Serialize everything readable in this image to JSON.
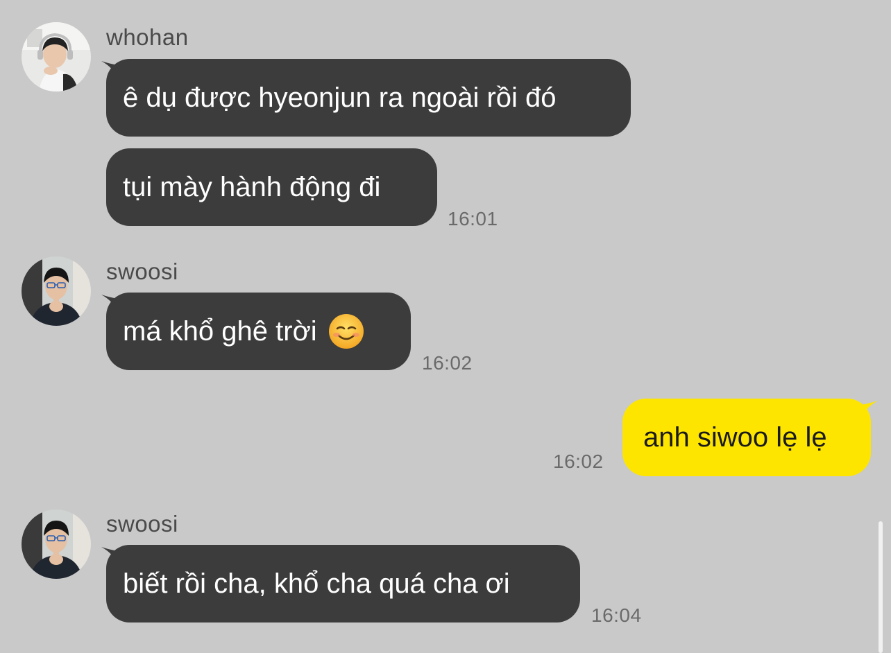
{
  "messages": [
    {
      "sender": "whohan",
      "lines": [
        "ê dụ được hyeonjun ra ngoài rồi đó",
        "tụi mày hành động đi"
      ],
      "time": "16:01"
    },
    {
      "sender": "swoosi",
      "text": "má khổ ghê trời",
      "emoji": "smiling-face-emoji",
      "time": "16:02"
    },
    {
      "sender": "me",
      "text": "anh siwoo lẹ lẹ",
      "time": "16:02"
    },
    {
      "sender": "swoosi",
      "text": "biết rồi cha, khổ cha quá cha ơi",
      "time": "16:04"
    }
  ],
  "colors": {
    "background": "#c9c9c9",
    "incoming_bubble": "#3c3c3c",
    "outgoing_bubble": "#fee500"
  }
}
